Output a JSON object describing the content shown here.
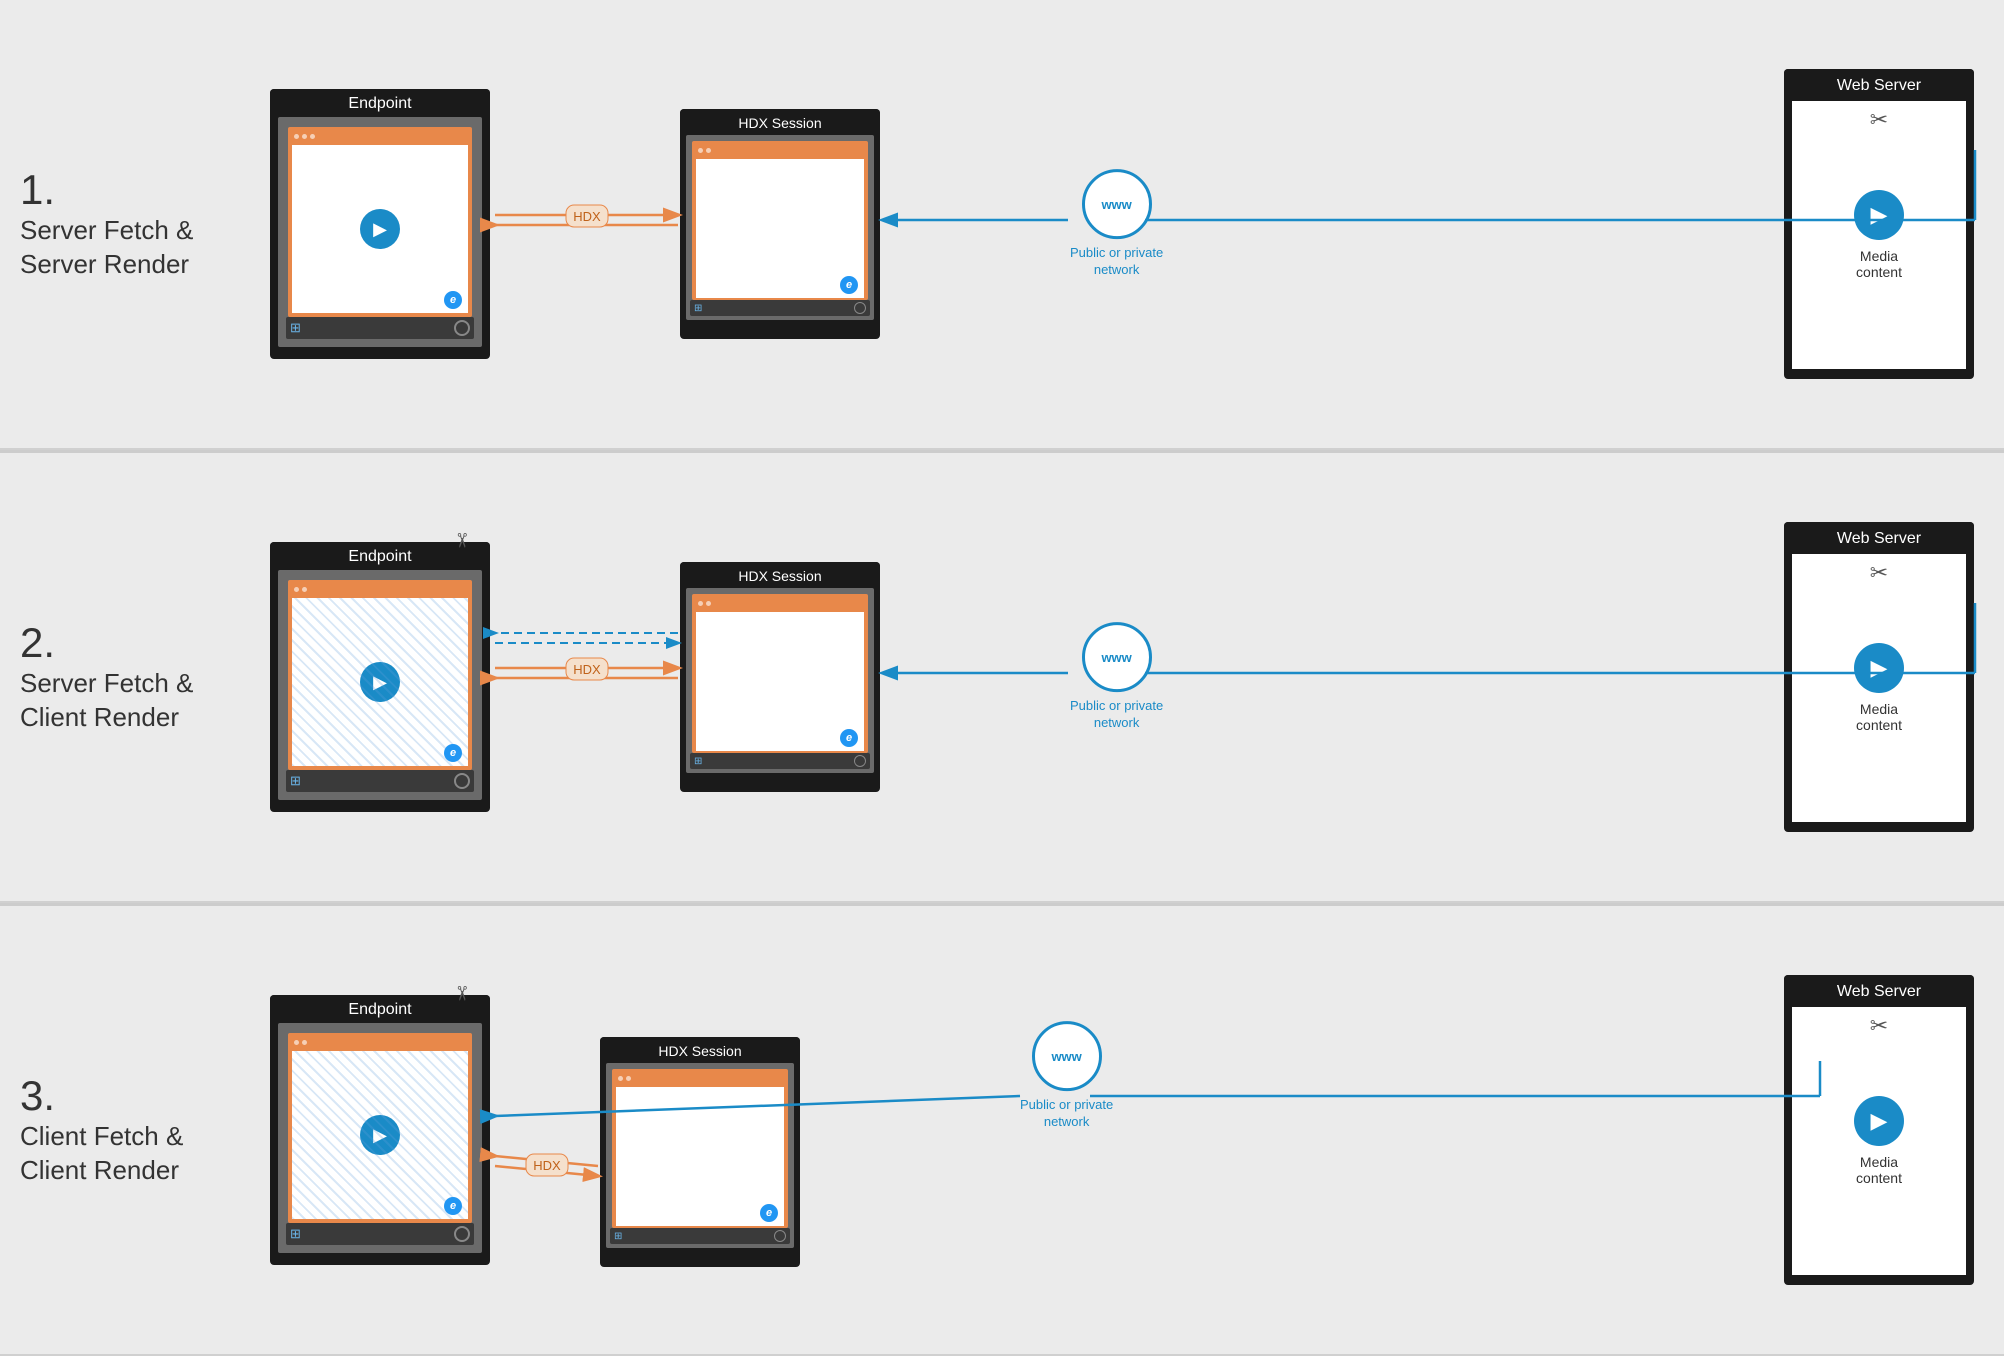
{
  "sections": [
    {
      "number": "1.",
      "title": "Server Fetch &\nServer Render",
      "endpoint_label": "Endpoint",
      "hdx_label": "HDX Session",
      "webserver_label": "Web Server",
      "media_label": "Media\ncontent",
      "network_label": "Public or private\nnetwork",
      "hdx_tag": "HDX",
      "scenario": "server_fetch_server_render"
    },
    {
      "number": "2.",
      "title": "Server Fetch &\nClient Render",
      "endpoint_label": "Endpoint",
      "hdx_label": "HDX Session",
      "webserver_label": "Web Server",
      "media_label": "Media\ncontent",
      "network_label": "Public or private\nnetwork",
      "hdx_tag": "HDX",
      "scenario": "server_fetch_client_render"
    },
    {
      "number": "3.",
      "title": "Client Fetch &\nClient Render",
      "endpoint_label": "Endpoint",
      "hdx_label": "HDX Session",
      "webserver_label": "Web Server",
      "media_label": "Media\ncontent",
      "network_label": "Public or private\nnetwork",
      "hdx_tag": "HDX",
      "scenario": "client_fetch_client_render"
    }
  ],
  "colors": {
    "orange": "#e8884a",
    "blue": "#1a8bc7",
    "dark": "#1a1a1a",
    "bg": "#ebebeb"
  }
}
